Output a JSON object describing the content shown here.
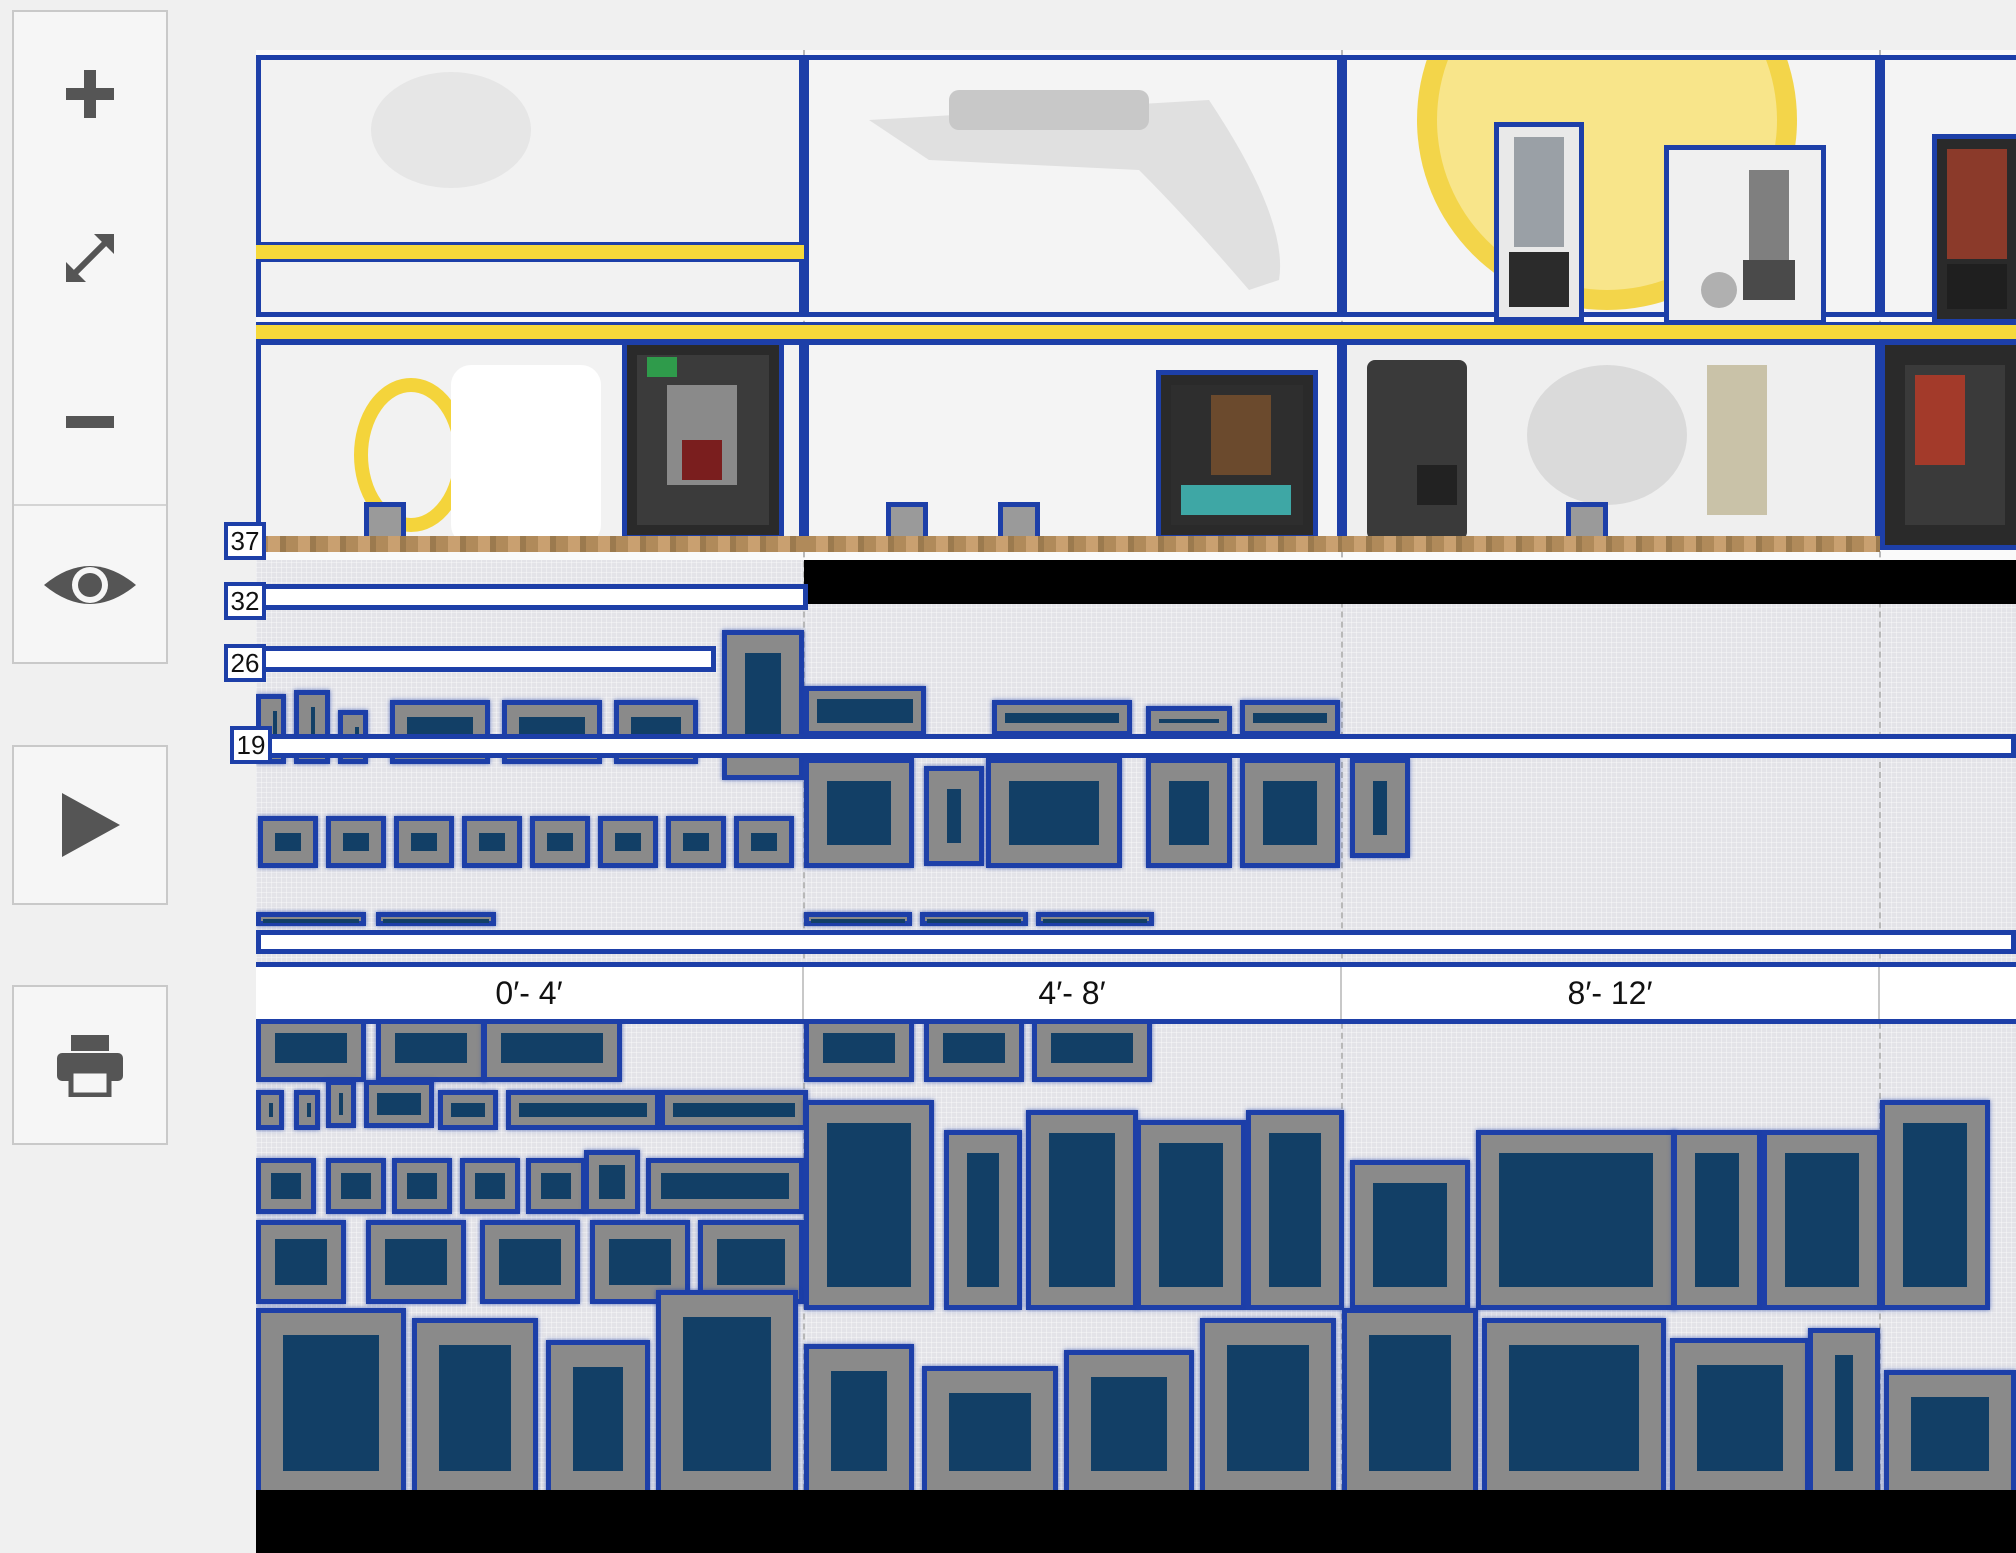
{
  "toolbar": {
    "zoom_in_icon": "plus-icon",
    "fit_icon": "expand-arrows-icon",
    "zoom_out_icon": "minus-icon",
    "view_icon": "eye-icon",
    "play_icon": "play-icon",
    "print_icon": "printer-icon"
  },
  "shelf_heights": [
    "37",
    "32",
    "26",
    "19"
  ],
  "ruler": {
    "segments": [
      "0′- 4′",
      "4′- 8′",
      "8′- 12′"
    ]
  },
  "colors": {
    "outline": "#1d3fa8",
    "product_fill": "#8a8a8a",
    "product_inner": "#123f66",
    "accent_yellow": "#f6d93a"
  }
}
